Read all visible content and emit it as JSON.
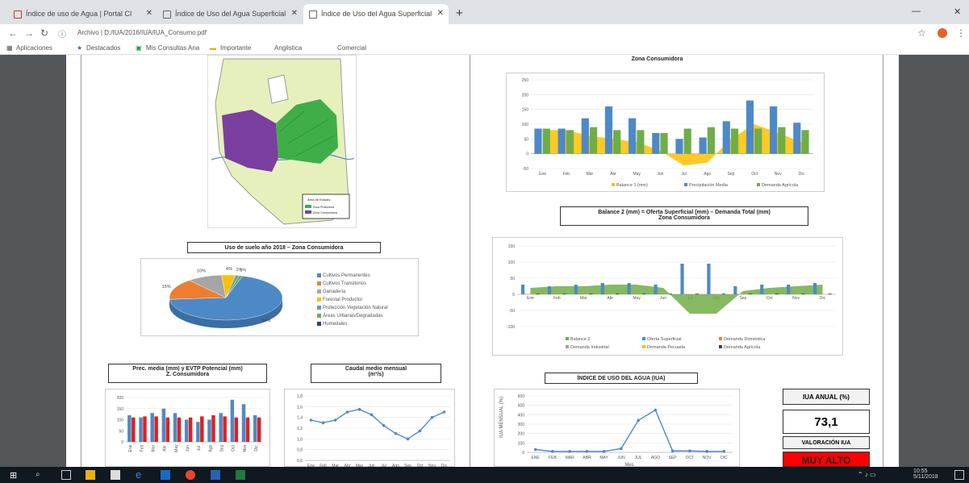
{
  "browser": {
    "tabs": [
      {
        "label": "Índice de uso de Agua | Portal CI"
      },
      {
        "label": "Índice de Uso del Agua Superficial"
      },
      {
        "label": "Índice de Uso del Agua Superficial"
      }
    ],
    "address": "Archivo | D:/IUA/2016/IUA/IUA_Consumo.pdf",
    "bookmarks": [
      "Aplicaciones",
      "Destacados",
      "Mis Consultas Ana",
      "Importante",
      "Anglistica",
      "Comercial"
    ]
  },
  "map": {
    "legend_title": "Área de Estudio",
    "legend_items": [
      {
        "label": "Zona Productora",
        "color": "#3fae49"
      },
      {
        "label": "Zona Consumidora",
        "color": "#7a3fa0"
      }
    ]
  },
  "pie": {
    "title": "Uso de suelo año 2018 – Zona Consumidora",
    "chart_data": {
      "type": "pie",
      "values": [
        69,
        15,
        10,
        4,
        1,
        1
      ],
      "labels": [
        "69%",
        "15%",
        "10%",
        "4%",
        "1%",
        "1%"
      ],
      "legend": [
        "Cultivos Permanentes",
        "Cultivos Transitorios",
        "Ganadería",
        "Forestal Productor",
        "Protección Vegetación Natural",
        "Áreas Urbanas/Degradadas",
        "Humedales"
      ],
      "colors": [
        "#4e89c7",
        "#ed7d31",
        "#a5a5a5",
        "#ffc000",
        "#5b9bd5",
        "#70ad47",
        "#264478"
      ]
    }
  },
  "top_right": {
    "title": "Zona Consumidora",
    "chart_data": {
      "type": "bar",
      "categories": [
        "Ene",
        "Feb",
        "Mar",
        "Abr",
        "May",
        "Jun",
        "Jul",
        "Ago",
        "Sep",
        "Oct",
        "Nov",
        "Dic"
      ],
      "ylim": [
        -50,
        250
      ],
      "yticks": [
        "250",
        "200",
        "150",
        "100",
        "50",
        "0",
        "-50"
      ],
      "series": [
        {
          "name": "Balance 1 (mm)",
          "type": "area",
          "color": "#ffc000",
          "values": [
            80,
            80,
            60,
            50,
            40,
            10,
            -40,
            -30,
            50,
            100,
            70,
            40
          ]
        },
        {
          "name": "Precipitación Media",
          "type": "bar",
          "color": "#4e89c7",
          "values": [
            85,
            85,
            120,
            160,
            120,
            70,
            50,
            55,
            110,
            180,
            160,
            105
          ]
        },
        {
          "name": "Demanda Agrícola",
          "type": "bar",
          "color": "#70ad47",
          "values": [
            85,
            80,
            90,
            80,
            80,
            70,
            85,
            90,
            85,
            85,
            90,
            80
          ]
        }
      ]
    }
  },
  "mid_right": {
    "title_line1": "Balance 2 (mm) = Oferta Superficial (mm) – Demanda Total (mm)",
    "title_line2": "Zona Consumidora",
    "chart_data": {
      "type": "bar",
      "categories": [
        "Ene",
        "Feb",
        "Mar",
        "Abr",
        "May",
        "Jun",
        "Jul",
        "Ago",
        "Sep",
        "Oct",
        "Nov",
        "Dic"
      ],
      "ylim": [
        -100,
        150
      ],
      "yticks": [
        "150",
        "100",
        "50",
        "0",
        "-50",
        "-100"
      ],
      "series": [
        {
          "name": "Balance 2",
          "type": "area",
          "color": "#70ad47",
          "values": [
            20,
            25,
            25,
            30,
            30,
            20,
            -60,
            -60,
            10,
            20,
            25,
            30
          ]
        },
        {
          "name": "Oferta Superficial",
          "type": "bar",
          "color": "#4e89c7",
          "values": [
            30,
            25,
            30,
            35,
            35,
            30,
            95,
            95,
            25,
            30,
            30,
            35
          ]
        },
        {
          "name": "Demanda Doméstica",
          "type": "bar",
          "color": "#ed7d31",
          "values": [
            1,
            1,
            1,
            1,
            1,
            1,
            1,
            1,
            1,
            1,
            1,
            1
          ]
        },
        {
          "name": "Demanda Industrial",
          "type": "bar",
          "color": "#a5a5a5",
          "values": [
            1,
            1,
            1,
            1,
            1,
            1,
            1,
            1,
            1,
            1,
            1,
            1
          ]
        },
        {
          "name": "Demanda Pecuaria",
          "type": "bar",
          "color": "#ffc000",
          "values": [
            1,
            1,
            1,
            1,
            1,
            1,
            1,
            1,
            1,
            1,
            1,
            1
          ]
        },
        {
          "name": "Demanda Agrícola",
          "type": "bar",
          "color": "#264478",
          "values": [
            2,
            2,
            2,
            2,
            2,
            2,
            2,
            2,
            2,
            2,
            2,
            2
          ]
        }
      ]
    }
  },
  "precip": {
    "title_line1": "Prec. media (mm) y EVTP Potencial (mm)",
    "title_line2": "Z. Consumidora",
    "chart_data": {
      "type": "bar",
      "categories": [
        "Ene",
        "Feb",
        "Mar",
        "Abr",
        "May",
        "Jun",
        "Jul",
        "Ago",
        "Sep",
        "Oct",
        "Nov",
        "Dic"
      ],
      "ylim": [
        0,
        200
      ],
      "yticks": [
        "200",
        "150",
        "100",
        "50",
        "0"
      ],
      "series": [
        {
          "name": "Precipitación",
          "color": "#4e89c7",
          "values": [
            120,
            110,
            130,
            150,
            130,
            100,
            90,
            100,
            130,
            190,
            170,
            120
          ]
        },
        {
          "name": "EVTP",
          "color": "#e02020",
          "values": [
            110,
            115,
            115,
            110,
            110,
            110,
            115,
            120,
            115,
            110,
            110,
            110
          ]
        }
      ]
    }
  },
  "caudal": {
    "title_line1": "Caudal medio mensual",
    "title_line2": "(m³/s)",
    "chart_data": {
      "type": "line",
      "categories": [
        "Ene",
        "Feb",
        "Mar",
        "Abr",
        "May",
        "Jun",
        "Jul",
        "Ago",
        "Sep",
        "Oct",
        "Nov",
        "Dic"
      ],
      "ylim": [
        0.6,
        1.8
      ],
      "yticks": [
        "1,8",
        "1,6",
        "1,4",
        "1,2",
        "1,0",
        "0,8",
        "0,6"
      ],
      "series": [
        {
          "name": "Caudal",
          "color": "#4e89c7",
          "values": [
            1.35,
            1.3,
            1.35,
            1.5,
            1.55,
            1.45,
            1.25,
            1.1,
            1.0,
            1.15,
            1.4,
            1.5
          ]
        }
      ]
    }
  },
  "iua_chart": {
    "title": "ÍNDICE DE USO DEL AGUA (IUA)",
    "ylabel": "IUA MENSUAL (%)",
    "xlabel": "Mes",
    "chart_data": {
      "type": "line",
      "categories": [
        "ENE",
        "FEB",
        "MAR",
        "ABR",
        "MAY",
        "JUN",
        "JUL",
        "AGO",
        "SEP",
        "OCT",
        "NOV",
        "DIC"
      ],
      "ylim": [
        0,
        600
      ],
      "yticks": [
        "600",
        "500",
        "400",
        "300",
        "200",
        "100",
        "0"
      ],
      "series": [
        {
          "name": "IUA",
          "color": "#4e89c7",
          "values": [
            30,
            10,
            10,
            10,
            10,
            40,
            340,
            450,
            15,
            15,
            10,
            10
          ]
        }
      ]
    }
  },
  "iua_annual": {
    "label": "IUA ANUAL (%)",
    "value": "73,1",
    "valuation_label": "VALORACIÓN IUA",
    "valuation": "MUY ALTO",
    "valuation_color": "#ff0000"
  },
  "taskbar": {
    "time": "10:55",
    "date": "5/11/2018"
  }
}
